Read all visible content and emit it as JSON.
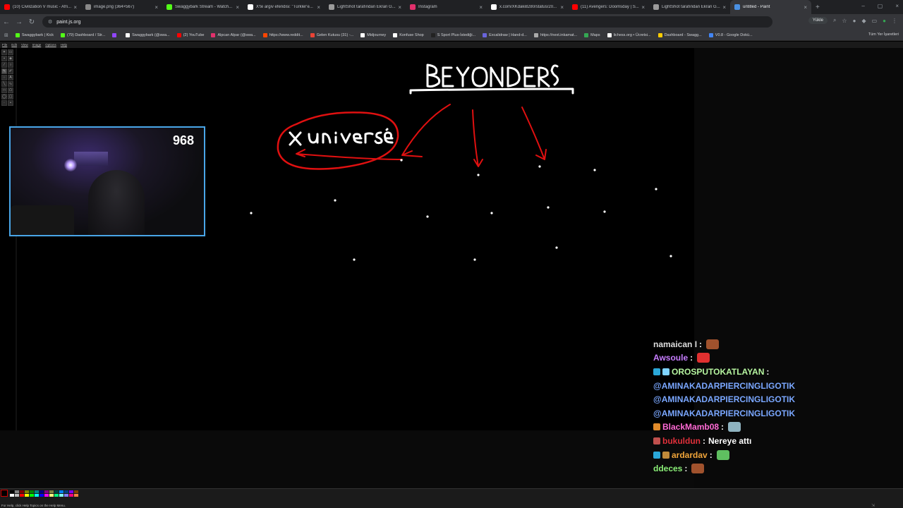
{
  "browser": {
    "tabs": [
      {
        "title": "(10) Civilization V music - Afri...",
        "color": "#ff0000"
      },
      {
        "title": "image.png (364×567)",
        "color": "#888888"
      },
      {
        "title": "Swaggybark Stream - Watch...",
        "color": "#53fc18"
      },
      {
        "title": "X'te argiv efendisi: \"Türkler'e...",
        "color": "#ffffff"
      },
      {
        "title": "LightShot tarafından Ekran G...",
        "color": "#9b9b9b"
      },
      {
        "title": "Instagram",
        "color": "#e1306c"
      },
      {
        "title": "x.com/XKdaki8280/status/20...",
        "color": "#ffffff"
      },
      {
        "title": "(11) Avengers: Doomsday | S...",
        "color": "#ff0000"
      },
      {
        "title": "LightShot tarafından Ekran G...",
        "color": "#9b9b9b"
      },
      {
        "title": "untitled - Paint",
        "color": "#4a90e2",
        "active": true
      }
    ],
    "new_tab_label": "+",
    "url": "paint.js.org",
    "upload_label": "Yükle",
    "bookmarks": [
      {
        "label": "Swaggybark | Kick",
        "color": "#53fc18"
      },
      {
        "label": "(79) Dashboard / Str...",
        "color": "#53fc18"
      },
      {
        "label": "",
        "color": "#9146ff"
      },
      {
        "label": "Swaggybark (@swa...",
        "color": "#ffffff"
      },
      {
        "label": "(2) YouTube",
        "color": "#ff0000"
      },
      {
        "label": "Alpcan Alpar (@swa...",
        "color": "#e1306c"
      },
      {
        "label": "https://www.reddit...",
        "color": "#ff4500"
      },
      {
        "label": "Gelen Kutusu (31) -...",
        "color": "#ea4335"
      },
      {
        "label": "Midjourney",
        "color": "#ffffff"
      },
      {
        "label": "Konfuse Shop",
        "color": "#ffffff"
      },
      {
        "label": "S Sport Plus-İstediği...",
        "color": "#222222"
      },
      {
        "label": "Excalidraw | Hand-d...",
        "color": "#6965db"
      },
      {
        "label": "https://next.inkamat...",
        "color": "#aaaaaa"
      },
      {
        "label": "Maps",
        "color": "#34a853"
      },
      {
        "label": "lichess.org • Ücretsi...",
        "color": "#ffffff"
      },
      {
        "label": "Dashboard - Swagg...",
        "color": "#ffcc00"
      },
      {
        "label": "V0.8 - Google Dokü...",
        "color": "#4285f4"
      }
    ],
    "all_bookmarks_label": "Tüm Yer İşaretleri"
  },
  "paint": {
    "menu": [
      "File",
      "Edit",
      "View",
      "Image",
      "Options",
      "Help"
    ],
    "status_text": "For Help, click Help Topics on the Help Menu."
  },
  "webcam": {
    "viewer_count": "968"
  },
  "chat": [
    {
      "user": "namaican I",
      "user_color": "#dddddd",
      "badges": [],
      "message": "",
      "emote": "#a0522d"
    },
    {
      "user": "Awsoule",
      "user_color": "#c77dff",
      "badges": [],
      "message": "",
      "emote": "#e03030"
    },
    {
      "user": "OROSPUTOKATLAYAN",
      "user_color": "#b6f5a0",
      "badges": [
        "#2aa7d8",
        "#7fd3ff"
      ],
      "message": "",
      "emote": ""
    },
    {
      "user": "",
      "user_color": "#7aa7ff",
      "badges": [],
      "mention": "@AMINAKADARPIERCINGLIGOTIK",
      "message": "",
      "emote": ""
    },
    {
      "user": "",
      "user_color": "#7aa7ff",
      "badges": [],
      "mention": "@AMINAKADARPIERCINGLIGOTIK",
      "message": "",
      "emote": ""
    },
    {
      "user": "",
      "user_color": "#7aa7ff",
      "badges": [],
      "mention": "@AMINAKADARPIERCINGLIGOTIK",
      "message": "",
      "emote": ""
    },
    {
      "user": "BlackMamb08",
      "user_color": "#ff6ad5",
      "badges": [
        "#e08a2a"
      ],
      "message": "",
      "emote": "#8fb3c0"
    },
    {
      "user": "bukuldun",
      "user_color": "#e0303a",
      "badges": [
        "#c0504d"
      ],
      "message": "Nereye attı",
      "emote": ""
    },
    {
      "user": "ardardav",
      "user_color": "#f0a53a",
      "badges": [
        "#2aa7d8",
        "#c08a3a"
      ],
      "message": "",
      "emote": "#5fbf60"
    },
    {
      "user": "ddeces",
      "user_color": "#8bf078",
      "badges": [],
      "message": "",
      "emote": "#a0522d"
    }
  ],
  "drawing": {
    "title_text": "BEYONDERS",
    "circled_text": "Xuniverse",
    "stroke_white": "#ffffff",
    "stroke_red": "#e01010"
  }
}
